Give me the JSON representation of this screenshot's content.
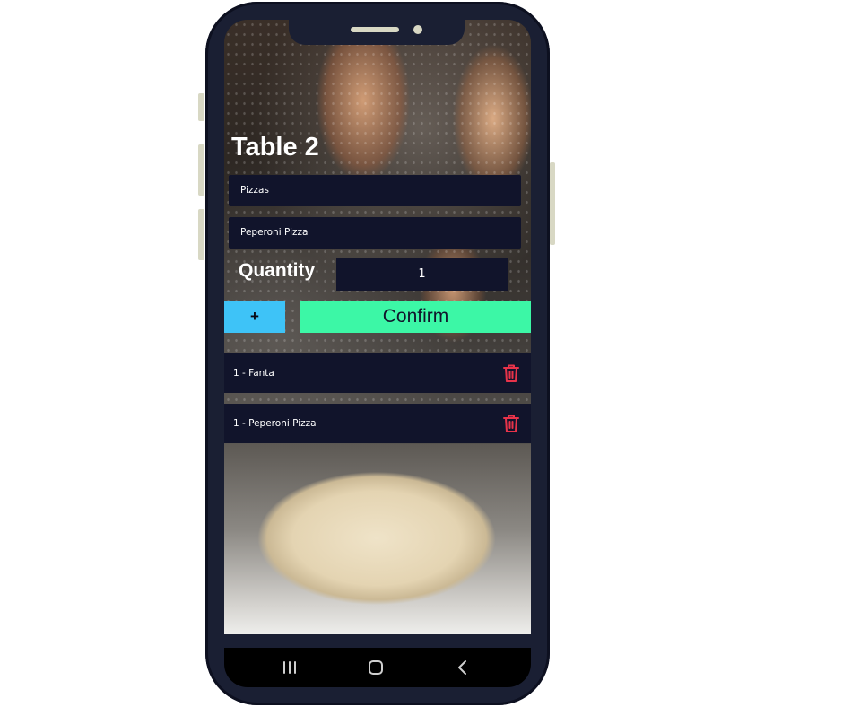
{
  "screen": {
    "title": "Table 2"
  },
  "form": {
    "category": "Pizzas",
    "item": "Peperoni Pizza",
    "quantity_label": "Quantity",
    "quantity_value": "1",
    "add_label": "+",
    "confirm_label": "Confirm"
  },
  "order_items": [
    {
      "label": "1 - Fanta",
      "icon": "trash-icon"
    },
    {
      "label": "1 - Peperoni Pizza",
      "icon": "trash-icon"
    }
  ],
  "nav": {
    "recents_icon": "recent-apps-icon",
    "home_icon": "home-icon",
    "back_icon": "back-icon"
  },
  "colors": {
    "panel": "#11142b",
    "accent_blue": "#3ec3f7",
    "accent_green": "#3cf7a6",
    "delete_red": "#e8334a",
    "phone_frame": "#1a1f33"
  }
}
